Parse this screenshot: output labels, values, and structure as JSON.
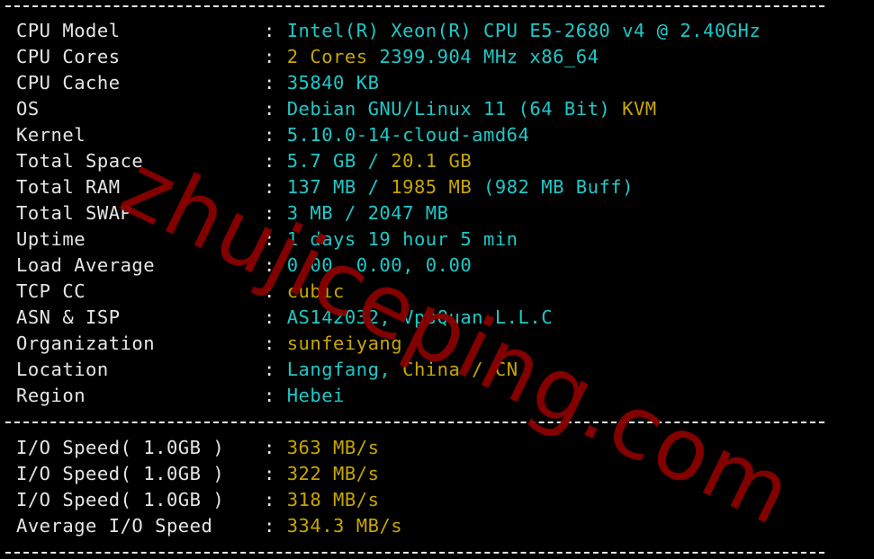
{
  "colors": {
    "background": "#000000",
    "label": "#e6e6e6",
    "cyan": "#1fc8c8",
    "gold": "#c8a600",
    "watermark": "#8a0000"
  },
  "separator": "-----------------------------------------------------------------------",
  "system_info": [
    {
      "label": "CPU Model",
      "parts": [
        {
          "text": "Intel(R) Xeon(R) CPU E5-2680 v4 @ 2.40GHz",
          "color": "cyan"
        }
      ]
    },
    {
      "label": "CPU Cores",
      "parts": [
        {
          "text": "2 Cores",
          "color": "gold"
        },
        {
          "text": " 2399.904 MHz x86_64",
          "color": "cyan"
        }
      ]
    },
    {
      "label": "CPU Cache",
      "parts": [
        {
          "text": "35840 KB",
          "color": "cyan"
        }
      ]
    },
    {
      "label": "OS",
      "parts": [
        {
          "text": "Debian GNU/Linux 11 (64 Bit)",
          "color": "cyan"
        },
        {
          "text": " KVM",
          "color": "gold"
        }
      ]
    },
    {
      "label": "Kernel",
      "parts": [
        {
          "text": "5.10.0-14-cloud-amd64",
          "color": "cyan"
        }
      ]
    },
    {
      "label": "Total Space",
      "parts": [
        {
          "text": "5.7 GB / ",
          "color": "cyan"
        },
        {
          "text": "20.1 GB",
          "color": "gold"
        }
      ]
    },
    {
      "label": "Total RAM",
      "parts": [
        {
          "text": "137 MB / ",
          "color": "cyan"
        },
        {
          "text": "1985 MB",
          "color": "gold"
        },
        {
          "text": " (982 MB Buff)",
          "color": "cyan"
        }
      ]
    },
    {
      "label": "Total SWAP",
      "parts": [
        {
          "text": "3 MB / 2047 MB",
          "color": "cyan"
        }
      ]
    },
    {
      "label": "Uptime",
      "parts": [
        {
          "text": "1 days 19 hour 5 min",
          "color": "cyan"
        }
      ]
    },
    {
      "label": "Load Average",
      "parts": [
        {
          "text": "0.00, 0.00, 0.00",
          "color": "cyan"
        }
      ]
    },
    {
      "label": "TCP CC",
      "parts": [
        {
          "text": "cubic",
          "color": "gold"
        }
      ]
    },
    {
      "label": "ASN & ISP",
      "parts": [
        {
          "text": "AS142032, VpsQuan L.L.C",
          "color": "cyan"
        }
      ]
    },
    {
      "label": "Organization",
      "parts": [
        {
          "text": "sunfeiyang",
          "color": "gold"
        }
      ]
    },
    {
      "label": "Location",
      "parts": [
        {
          "text": "Langfang, ",
          "color": "cyan"
        },
        {
          "text": "China / CN",
          "color": "gold"
        }
      ]
    },
    {
      "label": "Region",
      "parts": [
        {
          "text": "Hebei",
          "color": "cyan"
        }
      ]
    }
  ],
  "io_tests": [
    {
      "label": "I/O Speed( 1.0GB )",
      "value": "363 MB/s"
    },
    {
      "label": "I/O Speed( 1.0GB )",
      "value": "322 MB/s"
    },
    {
      "label": "I/O Speed( 1.0GB )",
      "value": "318 MB/s"
    },
    {
      "label": "Average I/O Speed",
      "value": "334.3 MB/s"
    }
  ],
  "colon": ": ",
  "watermark": "zhujiceping.com"
}
